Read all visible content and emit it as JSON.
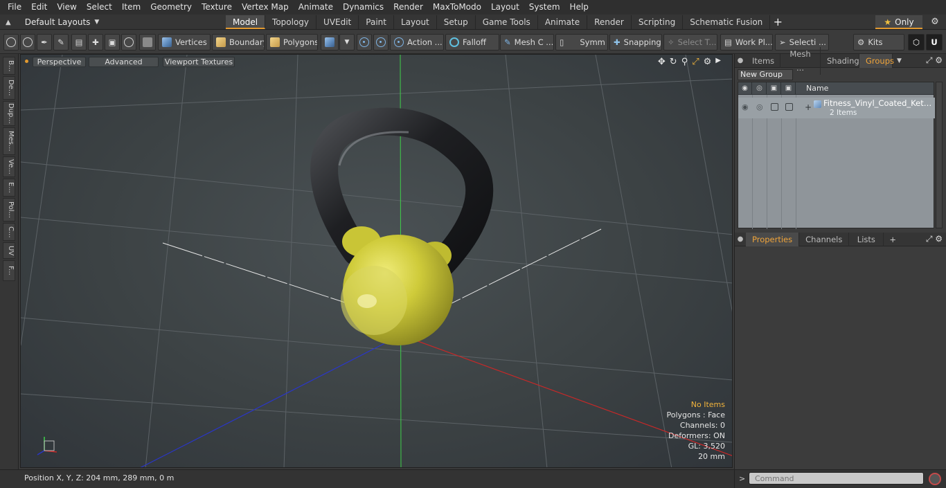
{
  "menu": [
    "File",
    "Edit",
    "View",
    "Select",
    "Item",
    "Geometry",
    "Texture",
    "Vertex Map",
    "Animate",
    "Dynamics",
    "Render",
    "MaxToModo",
    "Layout",
    "System",
    "Help"
  ],
  "layouts": {
    "label": "Default Layouts"
  },
  "tabs": [
    {
      "label": "Model",
      "active": true
    },
    {
      "label": "Topology"
    },
    {
      "label": "UVEdit"
    },
    {
      "label": "Paint"
    },
    {
      "label": "Layout"
    },
    {
      "label": "Setup"
    },
    {
      "label": "Game Tools"
    },
    {
      "label": "Animate"
    },
    {
      "label": "Render"
    },
    {
      "label": "Scripting"
    },
    {
      "label": "Schematic Fusion"
    }
  ],
  "only": {
    "label": "Only"
  },
  "toolbar": {
    "vertices": "Vertices",
    "boundary": "Boundary",
    "polygons": "Polygons",
    "action": "Action ...",
    "falloff": "Falloff",
    "mesh": "Mesh C ...",
    "symm": "Symm ...",
    "snapping": "Snapping",
    "select_t": "Select T...",
    "workplane": "Work Pl...",
    "selection": "Selecti ...",
    "kits": "Kits"
  },
  "side_tabs": [
    "B...",
    "De...",
    "Dup...",
    "Mes...",
    "Ve...",
    "E...",
    "Pol...",
    "C...",
    "UV",
    "F..."
  ],
  "viewport": {
    "perspective": "Perspective",
    "advanced": "Advanced",
    "textures": "Viewport Textures",
    "info": {
      "items": "No Items",
      "polygons": "Polygons : Face",
      "channels": "Channels: 0",
      "deformers": "Deformers: ON",
      "gl": "GL: 3,520",
      "scale": "20 mm"
    }
  },
  "status": {
    "position": "Position X, Y, Z:   204 mm, 289 mm, 0 m"
  },
  "panel_top": {
    "tabs": [
      {
        "label": "Items"
      },
      {
        "label": "Mesh ..."
      },
      {
        "label": "Shading"
      },
      {
        "label": "Groups",
        "active": true
      }
    ],
    "new_group": "New Group",
    "column_name": "Name",
    "group": {
      "name": "Fitness_Vinyl_Coated_Kettlebell",
      "count": "2 Items"
    }
  },
  "panel_bottom": {
    "tabs": [
      {
        "label": "Properties",
        "active": true
      },
      {
        "label": "Channels"
      },
      {
        "label": "Lists"
      }
    ]
  },
  "command": {
    "placeholder": "Command"
  },
  "colors": {
    "accent": "#e39a2f",
    "kettlebell": "#cfcb3a",
    "handle": "#1e1f22"
  }
}
